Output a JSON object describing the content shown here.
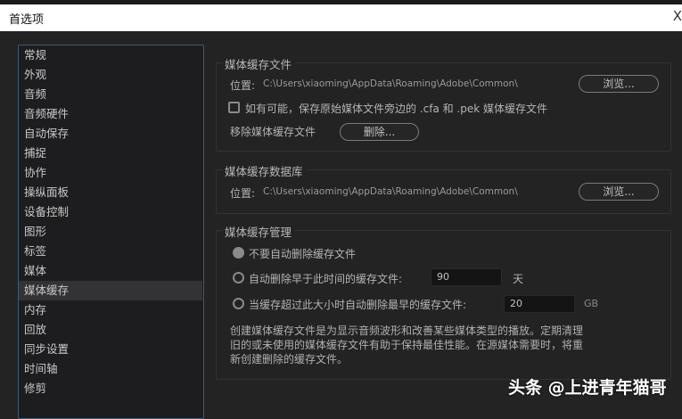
{
  "window": {
    "title": "首选项",
    "close": "X"
  },
  "sidebar": {
    "items": [
      "常规",
      "外观",
      "音频",
      "音频硬件",
      "自动保存",
      "捕捉",
      "协作",
      "操纵面板",
      "设备控制",
      "图形",
      "标签",
      "媒体",
      "媒体缓存",
      "内存",
      "回放",
      "同步设置",
      "时间轴",
      "修剪"
    ],
    "selected": "媒体缓存"
  },
  "cache_files": {
    "title": "媒体缓存文件",
    "location_label": "位置:",
    "location": "C:\\Users\\xiaoming\\AppData\\Roaming\\Adobe\\Common\\",
    "browse": "浏览...",
    "save_beside_label": "如有可能，保存原始媒体文件旁边的 .cfa 和 .pek 媒体缓存文件",
    "save_beside_checked": false,
    "remove_label": "移除媒体缓存文件",
    "delete": "删除..."
  },
  "cache_db": {
    "title": "媒体缓存数据库",
    "location_label": "位置:",
    "location": "C:\\Users\\xiaoming\\AppData\\Roaming\\Adobe\\Common\\",
    "browse": "浏览..."
  },
  "cache_mgmt": {
    "title": "媒体缓存管理",
    "option_none": "不要自动删除缓存文件",
    "option_age": "自动删除早于此时间的缓存文件:",
    "age_value": "90",
    "age_unit": "天",
    "option_size": "当缓存超过此大小时自动删除最早的缓存文件:",
    "size_value": "20",
    "size_unit": "GB",
    "selected": "none",
    "description": "创建媒体缓存文件是为显示音频波形和改善某些媒体类型的播放。定期清理旧的或未使用的媒体缓存文件有助于保持最佳性能。在源媒体需要时，将重新创建删除的缓存文件。"
  },
  "watermark": "头条 @上进青年猫哥"
}
